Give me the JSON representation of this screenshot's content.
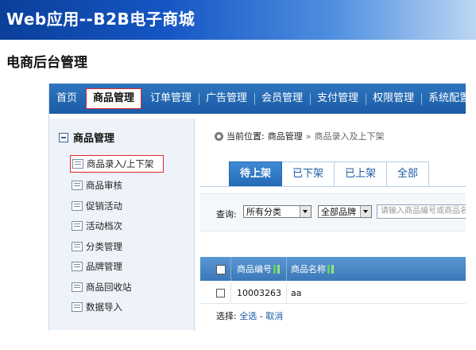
{
  "slide": {
    "banner_title": "Web应用--B2B电子商城",
    "subtitle": "电商后台管理",
    "banner_color": "#1556c4"
  },
  "topnav": {
    "items": [
      {
        "label": "首页",
        "active": false
      },
      {
        "label": "商品管理",
        "active": true
      },
      {
        "label": "订单管理",
        "active": false
      },
      {
        "label": "广告管理",
        "active": false
      },
      {
        "label": "会员管理",
        "active": false
      },
      {
        "label": "支付管理",
        "active": false
      },
      {
        "label": "权限管理",
        "active": false
      },
      {
        "label": "系统配置",
        "active": false
      }
    ]
  },
  "sidebar": {
    "heading": "商品管理",
    "heading_icon": "minus-box-icon",
    "items": [
      {
        "label": "商品录入/上下架",
        "selected": true
      },
      {
        "label": "商品审核",
        "selected": false
      },
      {
        "label": "促销活动",
        "selected": false
      },
      {
        "label": "活动档次",
        "selected": false
      },
      {
        "label": "分类管理",
        "selected": false
      },
      {
        "label": "品牌管理",
        "selected": false
      },
      {
        "label": "商品回收站",
        "selected": false
      },
      {
        "label": "数据导入",
        "selected": false
      }
    ]
  },
  "main": {
    "breadcrumb": {
      "prefix": "当前位置:",
      "section": "商品管理",
      "separator": "»",
      "page": "商品录入及上下架"
    },
    "tabs": [
      {
        "label": "待上架",
        "active": true
      },
      {
        "label": "已下架",
        "active": false
      },
      {
        "label": "已上架",
        "active": false
      },
      {
        "label": "全部",
        "active": false
      }
    ],
    "filter": {
      "label": "查询:",
      "category_value": "所有分类",
      "brand_value": "全部品牌",
      "search_placeholder": "请输入商品编号或商品名"
    },
    "table": {
      "columns": [
        "商品编号",
        "商品名称"
      ],
      "rows": [
        {
          "code": "10003263",
          "name": "aa"
        }
      ]
    },
    "selection": {
      "label": "选择:",
      "select_all": "全选",
      "dash": "-",
      "cancel": "取消"
    }
  },
  "accent_colors": {
    "nav": "#1a5ba6",
    "highlight_border": "#e0262b"
  }
}
